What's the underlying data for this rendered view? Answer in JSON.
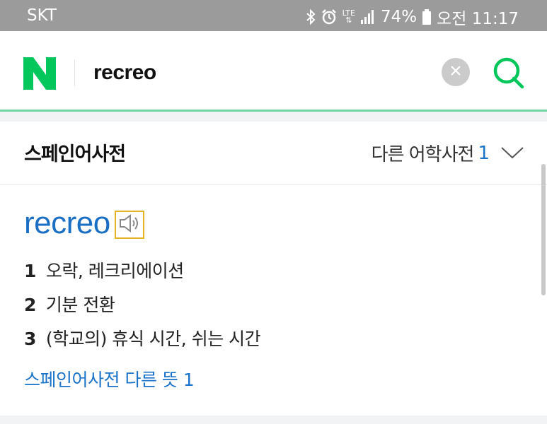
{
  "status_bar": {
    "carrier": "SKT",
    "network": "LTE",
    "battery": "74%",
    "time": "오전 11:17",
    "icons": [
      "bluetooth-icon",
      "alarm-icon",
      "signal-icon",
      "battery-icon"
    ]
  },
  "search": {
    "logo": "N",
    "query": "recreo",
    "icons": [
      "clear-icon",
      "search-icon"
    ]
  },
  "dictionary": {
    "title": "스페인어사전",
    "other_dicts_label": "다른 어학사전",
    "other_dicts_count": "1",
    "entry": {
      "word": "recreo",
      "meanings": [
        {
          "num": "1",
          "text": "오락, 레크리에이션"
        },
        {
          "num": "2",
          "text": "기분 전환"
        },
        {
          "num": "3",
          "text": "(학교의) 휴식 시간, 쉬는 시간"
        }
      ],
      "more_link": "스페인어사전 다른 뜻 1"
    }
  },
  "colors": {
    "naver_green": "#03c75a",
    "link_blue": "#1a73c9",
    "word_blue": "#1a6fc4",
    "accent_line": "#6fd6a3",
    "speaker_border": "#e7b326"
  }
}
